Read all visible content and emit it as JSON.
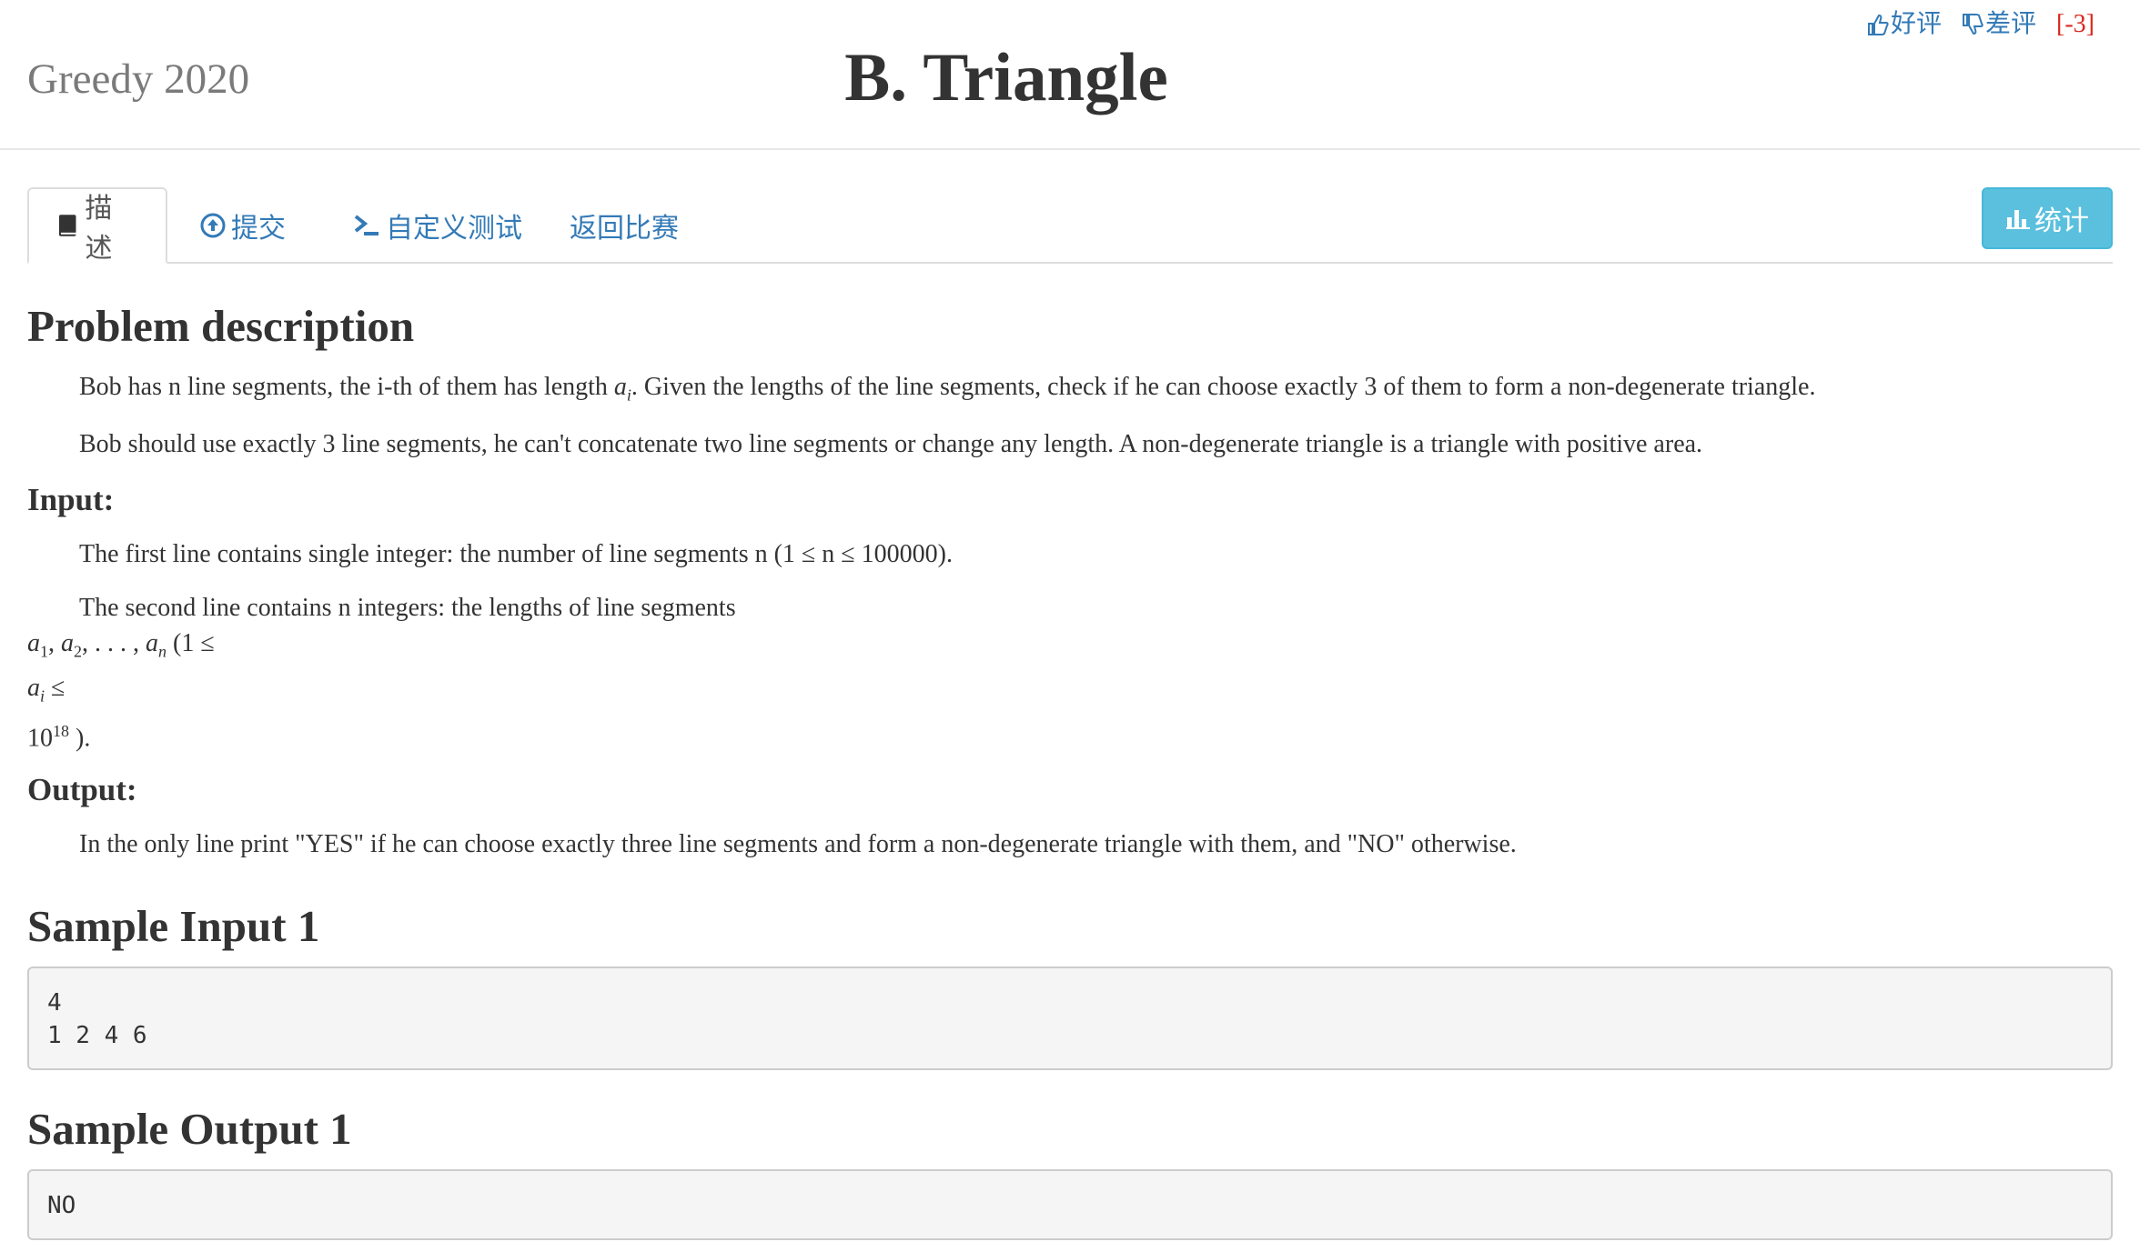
{
  "header": {
    "contest_name": "Greedy 2020",
    "problem_title": "B. Triangle",
    "good_label": "好评",
    "bad_label": "差评",
    "score": "[-3]"
  },
  "tabs": {
    "description": "描述",
    "submit": "提交",
    "custom_test": "自定义测试",
    "back": "返回比赛",
    "stats": "统计"
  },
  "problem": {
    "description_heading": "Problem description",
    "desc_p1_a": "Bob has n line segments, the i-th of them has length ",
    "desc_p1_b": ". Given the lengths of the line segments, check if he can choose exactly 3 of them to form a non-degenerate triangle.",
    "desc_p2": "Bob should use exactly 3 line segments, he can't concatenate two line segments or change any length. A non-degenerate triangle is a triangle with positive area.",
    "input_heading": "Input:",
    "input_p1": "The first line contains single integer: the number of line segments n (1 ≤ n ≤ 100000).",
    "input_p2": "The second line contains n integers: the lengths of line segments",
    "output_heading": "Output:",
    "output_p1": "In the only line print \"YES\" if he can choose exactly three line segments and form a non-degenerate triangle with them, and \"NO\" otherwise."
  },
  "samples": {
    "input_heading": "Sample Input 1",
    "input_value": "4\n1 2 4 6",
    "output_heading": "Sample Output 1",
    "output_value": "NO"
  },
  "colors": {
    "link": "#337ab7",
    "score_red": "#d9281e",
    "stats_button": "#5bc0de"
  }
}
